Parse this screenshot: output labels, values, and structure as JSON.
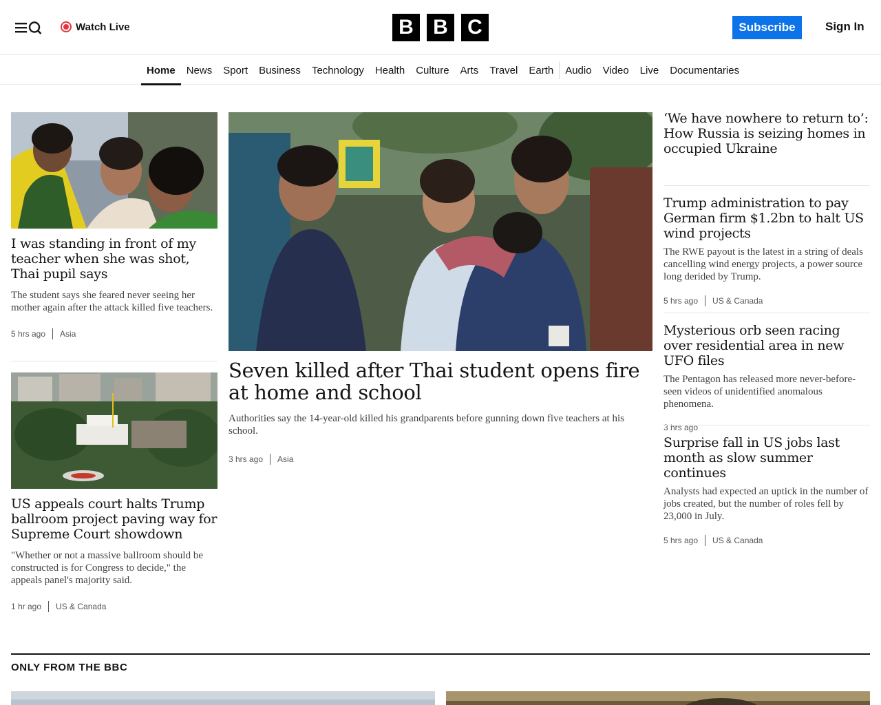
{
  "header": {
    "watch_live": "Watch Live",
    "logo_letters": [
      "B",
      "B",
      "C"
    ],
    "subscribe": "Subscribe",
    "sign_in": "Sign In"
  },
  "nav": {
    "items": [
      "Home",
      "News",
      "Sport",
      "Business",
      "Technology",
      "Health",
      "Culture",
      "Arts",
      "Travel",
      "Earth",
      "Audio",
      "Video",
      "Live",
      "Documentaries"
    ],
    "active": "Home"
  },
  "stories": {
    "left1": {
      "headline": "I was standing in front of my teacher when she was shot, Thai pupil says",
      "summary": "The student says she feared never seeing her mother again after the attack killed five teachers.",
      "time": "5 hrs ago",
      "category": "Asia"
    },
    "left2": {
      "headline": "US appeals court halts Trump ballroom project paving way for Supreme Court showdown",
      "summary": "\"Whether or not a massive ballroom should be constructed is for Congress to decide,\" the appeals panel's majority said.",
      "time": "1 hr ago",
      "category": "US & Canada"
    },
    "main": {
      "headline": "Seven killed after Thai student opens fire at home and school",
      "summary": "Authorities say the 14-year-old killed his grandparents before gunning down five teachers at his school.",
      "time": "3 hrs ago",
      "category": "Asia"
    },
    "right1": {
      "headline": "‘We have nowhere to return to’: How Russia is seizing homes in occupied Ukraine"
    },
    "right2": {
      "headline": "Trump administration to pay German firm $1.2bn to halt US wind projects",
      "summary": "The RWE payout is the latest in a string of deals cancelling wind energy projects, a power source long derided by Trump.",
      "time": "5 hrs ago",
      "category": "US & Canada"
    },
    "right3": {
      "headline": "Mysterious orb seen racing over residential area in new UFO files",
      "summary": "The Pentagon has released more never-before-seen videos of unidentified anomalous phenomena.",
      "time": "3 hrs ago"
    },
    "right4": {
      "headline": "Surprise fall in US jobs last month as slow summer continues",
      "summary": "Analysts had expected an uptick in the number of jobs created, but the number of roles fell by 23,000 in July.",
      "time": "5 hrs ago",
      "category": "US & Canada"
    }
  },
  "section": {
    "title": "ONLY FROM THE BBC"
  },
  "colors": {
    "accent_blue": "#0c74e8",
    "live_red": "#e3343c",
    "text": "#141414"
  },
  "icons": {
    "menu": "menu-search-icon",
    "live": "live-dot-icon"
  }
}
